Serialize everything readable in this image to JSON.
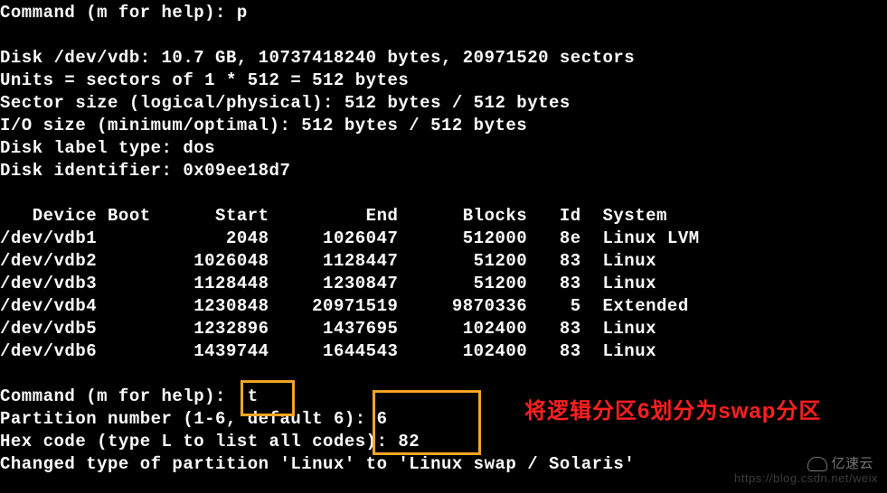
{
  "prompt1": "Command (m for help): p",
  "blank": "",
  "disk_info_line1": "Disk /dev/vdb: 10.7 GB, 10737418240 bytes, 20971520 sectors",
  "disk_info_line2": "Units = sectors of 1 * 512 = 512 bytes",
  "disk_info_line3": "Sector size (logical/physical): 512 bytes / 512 bytes",
  "disk_info_line4": "I/O size (minimum/optimal): 512 bytes / 512 bytes",
  "disk_info_line5": "Disk label type: dos",
  "disk_info_line6": "Disk identifier: 0x09ee18d7",
  "table_header": "   Device Boot      Start         End      Blocks   Id  System",
  "partitions": [
    "/dev/vdb1            2048     1026047      512000   8e  Linux LVM",
    "/dev/vdb2         1026048     1128447       51200   83  Linux",
    "/dev/vdb3         1128448     1230847       51200   83  Linux",
    "/dev/vdb4         1230848    20971519     9870336    5  Extended",
    "/dev/vdb5         1232896     1437695      102400   83  Linux",
    "/dev/vdb6         1439744     1644543      102400   83  Linux"
  ],
  "prompt2": "Command (m for help):  t",
  "prompt3": "Partition number (1-6, default 6): 6",
  "prompt4": "Hex code (type L to list all codes): 82",
  "result_line": "Changed type of partition 'Linux' to 'Linux swap / Solaris'",
  "annotation1": "将逻辑分区6划分为swap分区",
  "watermark": "https://blog.csdn.net/weix",
  "logo_text": "亿速云"
}
